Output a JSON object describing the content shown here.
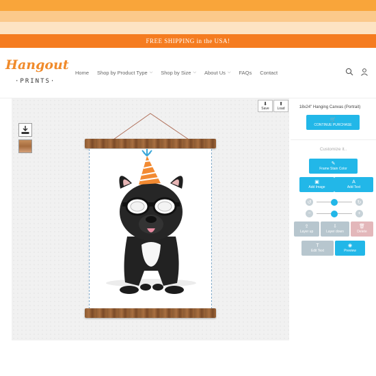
{
  "banner": {
    "shipping_text": "FREE SHIPPING in the USA!"
  },
  "brand": {
    "script": "Hangout",
    "sub": "·PRINTS·"
  },
  "nav": {
    "items": [
      {
        "label": "Home",
        "dropdown": false
      },
      {
        "label": "Shop by Product Type",
        "dropdown": true
      },
      {
        "label": "Shop by Size",
        "dropdown": true
      },
      {
        "label": "About Us",
        "dropdown": true
      },
      {
        "label": "FAQs",
        "dropdown": false
      },
      {
        "label": "Contact",
        "dropdown": false
      }
    ]
  },
  "header_icons": {
    "search": "search-icon",
    "account": "account-icon"
  },
  "toolbar": {
    "save_label": "Save",
    "load_label": "Load"
  },
  "panel": {
    "product_title": "18x24\" Hanging Canvas (Portrait)",
    "continue_label": "CONTINUE PURCHASE",
    "customize_label": "Customize it..",
    "frame_stain_label": "Frame Stain Color",
    "add_image_label": "Add Image",
    "add_text_label": "Add Text",
    "layer_up_label": "Layer up",
    "layer_down_label": "Layer down",
    "delete_label": "Delete",
    "edit_text_label": "Edit Text",
    "preview_label": "Preview",
    "rotate_level": 0.5,
    "scale_level": 0.5
  },
  "colors": {
    "accent_orange": "#f57c20",
    "button_blue": "#22b7e8",
    "button_grey": "#b7c6ce",
    "delete_pink": "#e3b7ba"
  }
}
